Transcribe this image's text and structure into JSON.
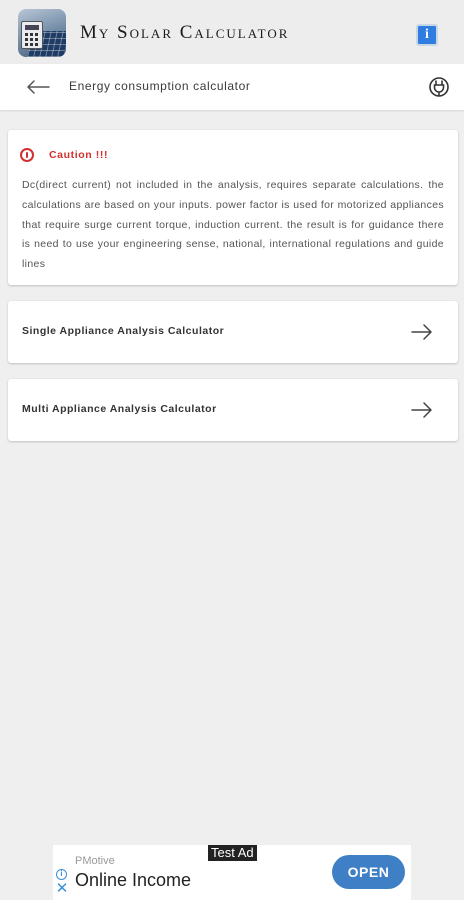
{
  "app": {
    "title": "My Solar Calculator",
    "logo_icon": "solar-calculator-logo",
    "info_icon": "info-icon"
  },
  "toolbar": {
    "title": "Energy consumption calculator",
    "back_icon": "arrow-left-icon",
    "plug_icon": "power-plug-icon"
  },
  "caution": {
    "label": "Caution !!!",
    "text": "Dc(direct current) not included in the analysis, requires separate calculations. the calculations are based on your inputs. power factor is used for motorized appliances that require surge current torque, induction current. the result is for guidance there is need to use your engineering sense, national, international regulations and guide lines",
    "color": "#d32f2f"
  },
  "options": [
    {
      "label": "Single Appliance Analysis Calculator",
      "icon": "arrow-right-icon"
    },
    {
      "label": "Multi Appliance Analysis Calculator",
      "icon": "arrow-right-icon"
    }
  ],
  "ad": {
    "tag": "Test Ad",
    "brand": "PMotive",
    "headline": "Online Income",
    "button": "OPEN",
    "button_color": "#3f7fc6"
  }
}
